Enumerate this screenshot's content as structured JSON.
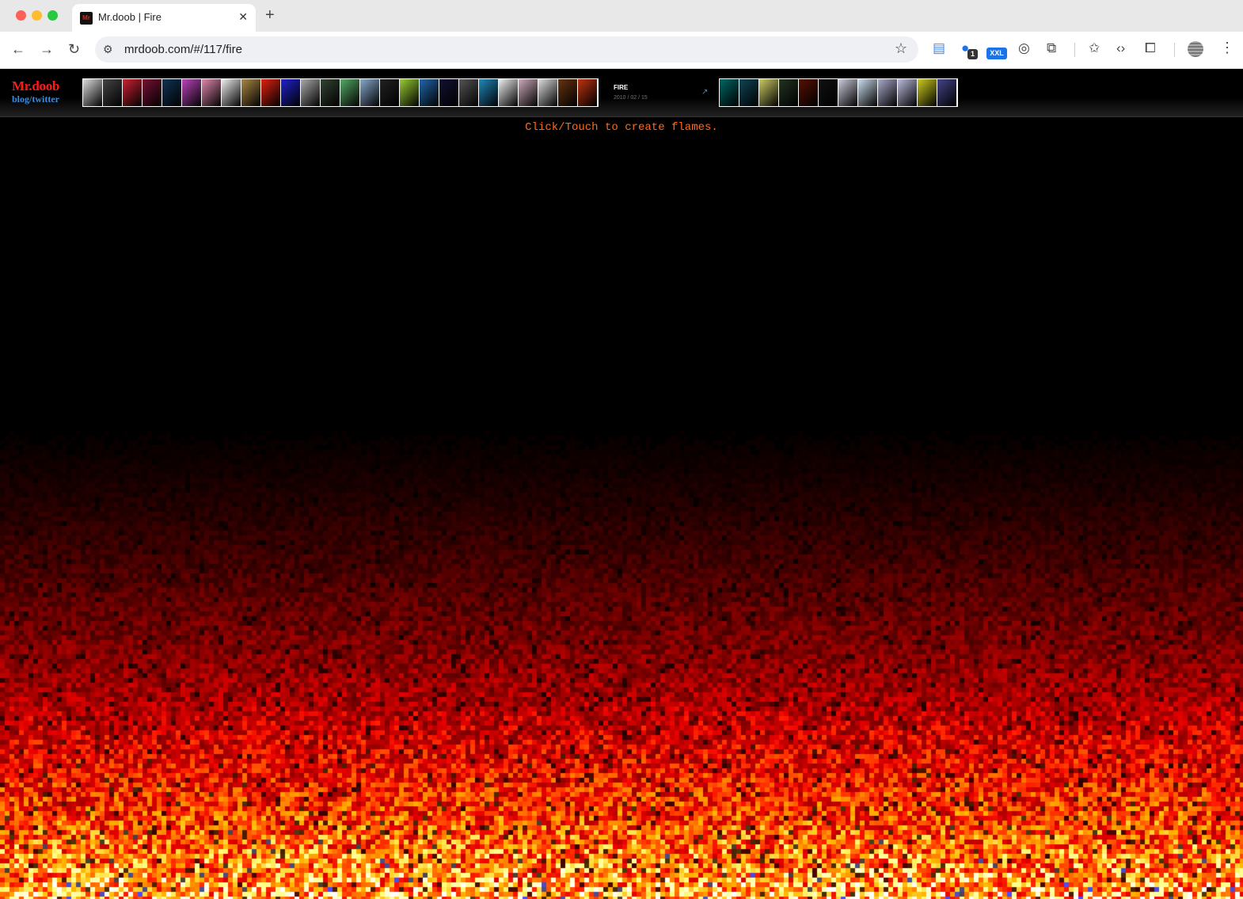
{
  "browser": {
    "tab_title": "Mr.doob | Fire",
    "tab_favicon_text": "Mr",
    "url": "mrdoob.com/#/117/fire",
    "ext_badge": "XXL",
    "ext_count": "1"
  },
  "header": {
    "logo": "Mr.doob",
    "sub": "blog/twitter",
    "item_title": "FIRE",
    "item_date": "2010 / 02 / 15"
  },
  "main": {
    "instructions": "Click/Touch to create flames."
  },
  "colors": {
    "logo": "#ff1a1a",
    "link": "#3a8dde",
    "instructions": "#ff6a1a"
  },
  "icons": [
    "back-arrow-icon",
    "forward-arrow-icon",
    "reload-icon",
    "site-info-icon",
    "bookmark-star-icon",
    "extension-icon",
    "puzzle-icon",
    "reading-list-icon",
    "code-icon",
    "tab-search-icon",
    "avatar",
    "menu-icon",
    "external-link-icon"
  ]
}
